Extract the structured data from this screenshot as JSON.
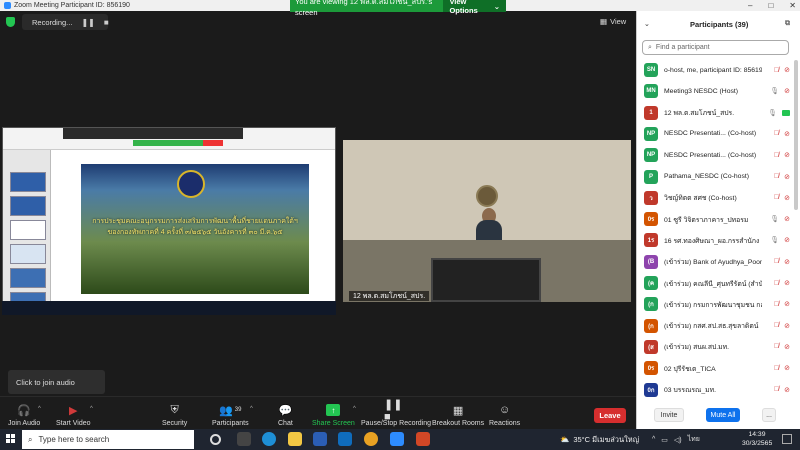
{
  "window": {
    "title": "Zoom Meeting Participant ID: 856190",
    "min": "–",
    "max": "□",
    "close": "✕"
  },
  "recording": {
    "label": "Recording...",
    "pause": "❚❚",
    "stop": "■"
  },
  "banner": {
    "text": "You are viewing 12 พล.ต.สมโภชน์_สปร.'s screen",
    "options": "View Options",
    "options_caret": "⌄"
  },
  "view_btn": {
    "label": "View",
    "icon": "grid-icon"
  },
  "slide": {
    "line1": "การประชุมคณะอนุกรรมการส่งเสริมการพัฒนาพื้นที่ชายแดนภาคใต้ฯ",
    "line2": "ของกองทัพภาคที่ 4 ครั้งที่ ๓/๒๕๖๕ วันอังคารที่ ๓๐ มี.ค.๖๕"
  },
  "video": {
    "name": "12 พล.ต.สมโภชน์_สปร."
  },
  "audio_tip": "Click to join audio",
  "toolbar": {
    "join_audio": "Join Audio",
    "start_video": "Start Video",
    "security": "Security",
    "participants": "Participants",
    "participants_count": "39",
    "chat": "Chat",
    "share_screen": "Share Screen",
    "recording": "Pause/Stop Recording",
    "breakout": "Breakout Rooms",
    "reactions": "Reactions",
    "leave": "Leave"
  },
  "panel": {
    "title": "Participants (39)",
    "search_placeholder": "Find a participant",
    "invite": "Invite",
    "mute_all": "Mute All",
    "more": "..."
  },
  "participants": [
    {
      "initials": "SN",
      "name": "o-host, me, participant ID: 856190)",
      "color": "#23a35a",
      "mic": "muted",
      "cam": "off"
    },
    {
      "initials": "MN",
      "name": "Meeting3 NESDC (Host)",
      "color": "#23a35a",
      "mic": "unmuted",
      "cam": "off"
    },
    {
      "initials": "1",
      "name": "12 พล.ต.สมโภชน์_สปร.",
      "color": "#c0392b",
      "mic": "unmuted",
      "cam": "on"
    },
    {
      "initials": "NP",
      "name": "NESDC Presentati... (Co-host)",
      "color": "#23a35a",
      "mic": "muted",
      "cam": "off"
    },
    {
      "initials": "NP",
      "name": "NESDC Presentati... (Co-host)",
      "color": "#23a35a",
      "mic": "muted",
      "cam": "off"
    },
    {
      "initials": "P",
      "name": "Pathama_NESDC (Co-host)",
      "color": "#23a35a",
      "mic": "muted",
      "cam": "off"
    },
    {
      "initials": "ว",
      "name": "วิชญ์ทิตต สศช (Co-host)",
      "color": "#c0392b",
      "mic": "muted",
      "cam": "off"
    },
    {
      "initials": "0ร",
      "name": "01 ซูรี วิจิตราภาคาร_ปทอรม",
      "color": "#d35400",
      "mic": "unmuted",
      "cam": "off"
    },
    {
      "initials": "1ร",
      "name": "16 รศ.ทองศิษณา_ผอ.กรรสำนักง",
      "color": "#c0392b",
      "mic": "unmuted",
      "cam": "off"
    },
    {
      "initials": "(B",
      "name": "(เข้าร่วม) Bank of Ayudhya_Poonsi...",
      "color": "#8e44ad",
      "mic": "muted",
      "cam": "off"
    },
    {
      "initials": "(ค",
      "name": "(เข้าร่วม) คณลีนี_ศุนทรีรัตน์ (สำนักงาน...",
      "color": "#23a35a",
      "mic": "muted",
      "cam": "off"
    },
    {
      "initials": "(ก",
      "name": "(เข้าร่วม) กรมการพัฒนาชุมชน กองแ...",
      "color": "#23a35a",
      "mic": "muted",
      "cam": "off"
    },
    {
      "initials": "(ก",
      "name": "(เข้าร่วม) กสศ.สป.สธ.สุขลาดิตน์",
      "color": "#d35400",
      "mic": "muted",
      "cam": "off"
    },
    {
      "initials": "(ส",
      "name": "(เข้าร่วม) สนผ.สป.มท.",
      "color": "#c0392b",
      "mic": "muted",
      "cam": "off"
    },
    {
      "initials": "0ร",
      "name": "02 ปุรีรัชเต_TICA",
      "color": "#d35400",
      "mic": "muted",
      "cam": "off"
    },
    {
      "initials": "0ก",
      "name": "03 บรรณรณ_มท.",
      "color": "#1f3a93",
      "mic": "muted",
      "cam": "off"
    }
  ],
  "win_taskbar": {
    "search_placeholder": "Type here to search",
    "weather": "35°C มีเมฆส่วนใหญ่",
    "lang": "ไทย",
    "time": "14:39",
    "date": "30/3/2565"
  }
}
